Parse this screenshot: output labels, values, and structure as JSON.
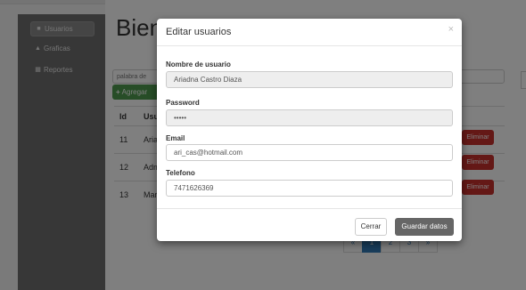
{
  "sidebar": {
    "items": [
      {
        "label": "Usuarios",
        "icon": "user-icon",
        "active": true
      },
      {
        "label": "Graficas",
        "icon": "chart-icon",
        "active": false
      },
      {
        "label": "Reportes",
        "icon": "table-icon",
        "active": false
      }
    ]
  },
  "main": {
    "title": "Bienv",
    "search_placeholder": "palabra de",
    "add_label": "Agregar",
    "table": {
      "headers": [
        "Id",
        "Usua"
      ],
      "rows": [
        {
          "id": "11",
          "user": "Ariadn"
        },
        {
          "id": "12",
          "user": "Admi"
        },
        {
          "id": "13",
          "user": "Marc"
        }
      ],
      "delete_label": "Eliminar"
    },
    "pager": [
      "«",
      "1",
      "2",
      "3",
      "»"
    ]
  },
  "modal": {
    "title": "Editar usuarios",
    "close": "×",
    "fields": {
      "username_label": "Nombre de usuario",
      "username_value": "Ariadna Castro Diaza",
      "password_label": "Password",
      "password_value": "•••••",
      "email_label": "Email",
      "email_value": "ari_cas@hotmail.com",
      "phone_label": "Telefono",
      "phone_value": "7471626369"
    },
    "buttons": {
      "close": "Cerrar",
      "save": "Guardar datos"
    }
  },
  "colors": {
    "overlay": "#000000",
    "save_button": "#666666",
    "delete_button": "#c9302c",
    "add_button": "#4e9a4e"
  }
}
